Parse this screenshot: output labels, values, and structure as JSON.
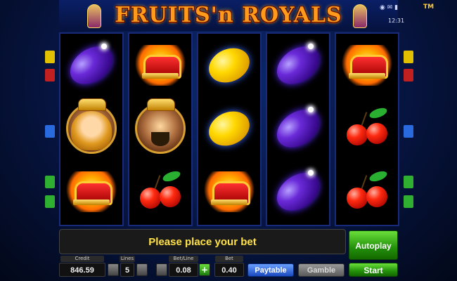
{
  "header": {
    "logo_text": "FRUITS'n ROYALS",
    "tm": "TM",
    "system_icons": "◉ ✉ ▮",
    "clock": "12:31"
  },
  "reels": [
    [
      "plum",
      "queen",
      "crown"
    ],
    [
      "crown",
      "king",
      "cherries"
    ],
    [
      "lemon",
      "lemon",
      "crown"
    ],
    [
      "plum",
      "plum",
      "plum"
    ],
    [
      "crown",
      "cherries",
      "cherries"
    ]
  ],
  "message": "Please place your bet",
  "controls": {
    "credit_label": "Credit",
    "credit_value": "846.59",
    "lines_label": "Lines",
    "lines_value": "5",
    "bet_line_label": "Bet/Line",
    "bet_line_value": "0.08",
    "bet_label": "Bet",
    "bet_value": "0.40",
    "paytable_label": "Paytable",
    "gamble_label": "Gamble",
    "autoplay_label": "Autoplay",
    "start_label": "Start",
    "plus_glyph": "+"
  },
  "colors": {
    "message_text": "#ffe24a",
    "accent_green": "#22900a",
    "accent_blue": "#1a4ac0",
    "side_markers": [
      "#f0d000",
      "#e02020",
      "#30b030",
      "#2a6adf",
      "#d040d0"
    ]
  }
}
